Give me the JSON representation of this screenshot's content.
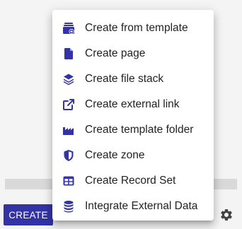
{
  "menu": {
    "items": [
      {
        "label": "Create from template",
        "icon": "template-stack-icon"
      },
      {
        "label": "Create page",
        "icon": "file-icon"
      },
      {
        "label": "Create file stack",
        "icon": "layers-icon"
      },
      {
        "label": "Create external link",
        "icon": "external-link-icon"
      },
      {
        "label": "Create template folder",
        "icon": "factory-icon"
      },
      {
        "label": "Create zone",
        "icon": "shield-icon"
      },
      {
        "label": "Create Record Set",
        "icon": "table-icon"
      },
      {
        "label": "Integrate External Data",
        "icon": "database-icon"
      }
    ]
  },
  "toolbar": {
    "create_label": "CREATE",
    "settings_icon": "gear-icon"
  },
  "colors": {
    "accent": "#3333a6",
    "background": "#f4f4f4",
    "menu_bg": "#ffffff",
    "text": "#222222"
  }
}
